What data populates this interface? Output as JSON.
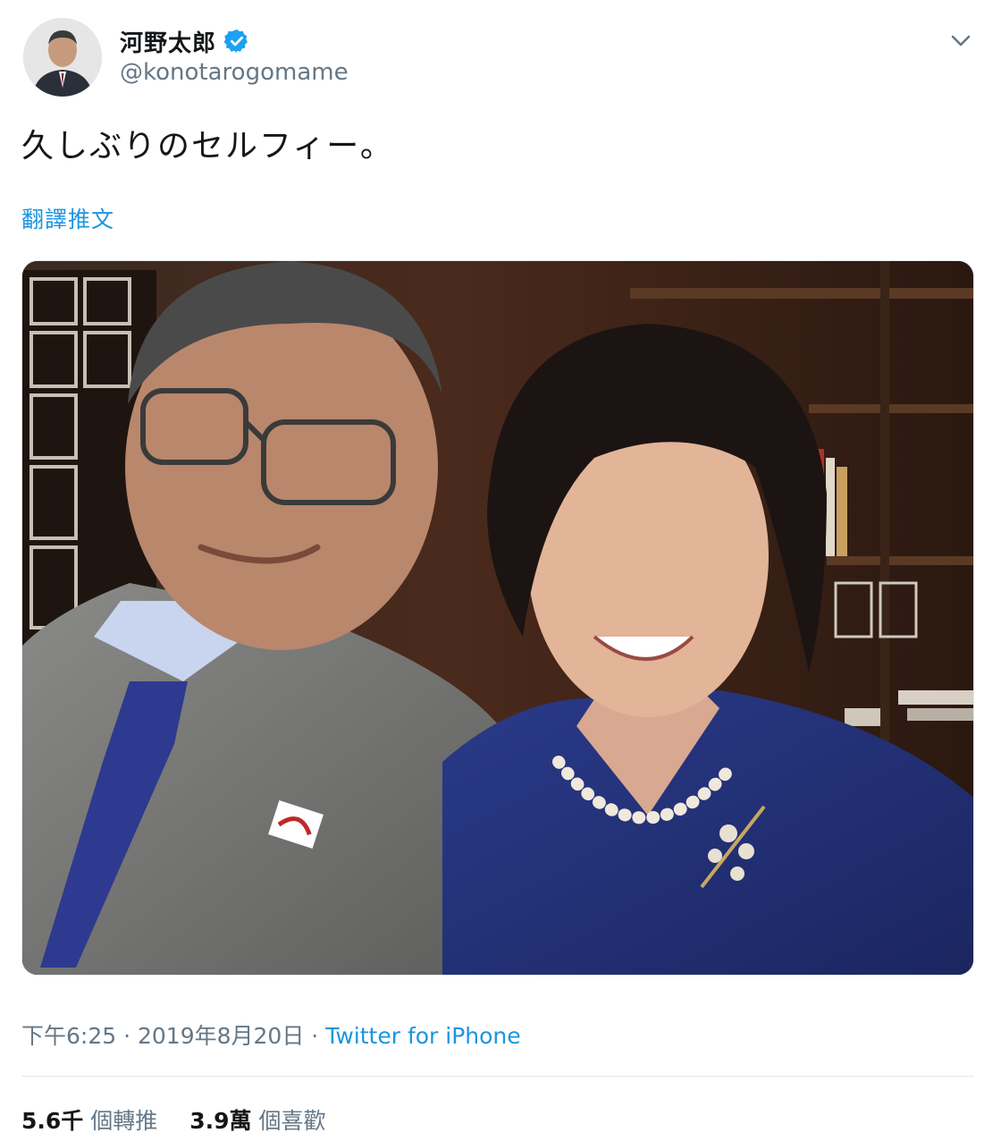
{
  "author": {
    "display_name": "河野太郎",
    "handle": "@konotarogomame",
    "verified": true,
    "avatar_icon": "avatar-photo"
  },
  "tweet": {
    "text": "久しぶりのセルフィー。",
    "translate_label": "翻譯推文",
    "media_icon": "selfie-photo"
  },
  "meta": {
    "time": "下午6:25",
    "date": "2019年8月20日",
    "separator": "·",
    "source": "Twitter for iPhone"
  },
  "stats": {
    "retweets_count": "5.6千",
    "retweets_label": "個轉推",
    "likes_count": "3.9萬",
    "likes_label": "個喜歡"
  },
  "colors": {
    "link": "#1b95e0",
    "secondary_text": "#657786",
    "primary_text": "#14171a",
    "verified": "#1da1f2"
  }
}
